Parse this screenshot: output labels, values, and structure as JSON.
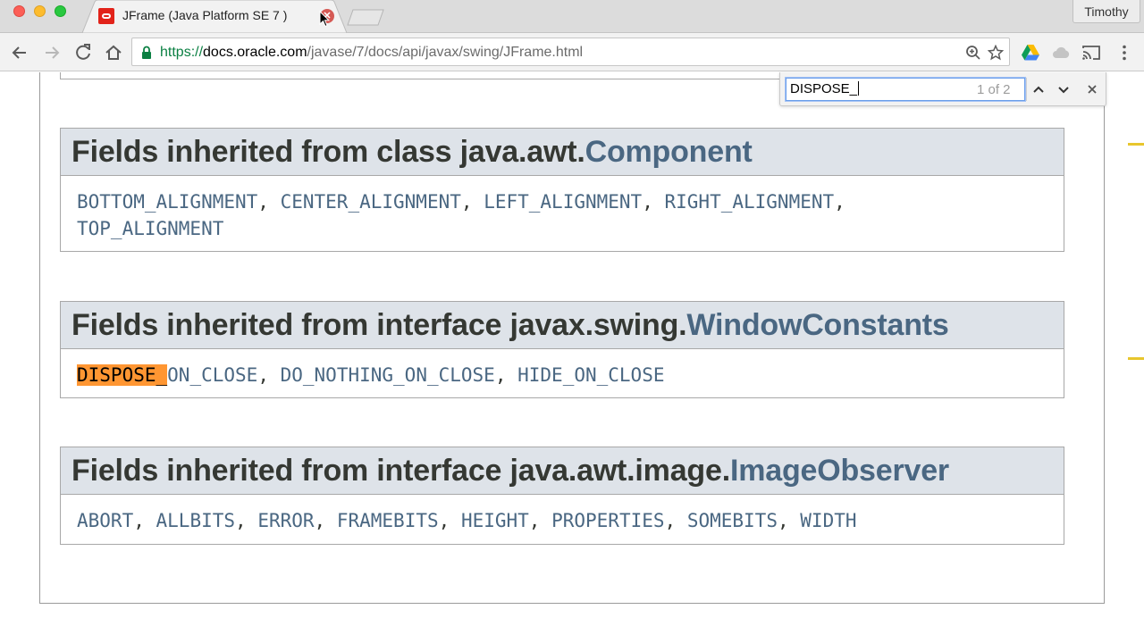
{
  "browser": {
    "profile_name": "Timothy",
    "tab": {
      "title": "JFrame (Java Platform SE 7 )",
      "close_icon": "close-icon",
      "favicon": "oracle-favicon"
    },
    "url": {
      "scheme": "https://",
      "host": "docs.oracle.com",
      "path": "/javase/7/docs/api/javax/swing/JFrame.html"
    },
    "nav_icons": [
      "back-arrow-icon",
      "forward-arrow-icon",
      "reload-icon",
      "home-icon"
    ],
    "omnibox_icons": [
      "zoom-icon",
      "bookmark-star-icon"
    ],
    "extension_icons": [
      "google-drive-icon",
      "cloud-icon",
      "cast-icon",
      "menu-kebab-icon"
    ]
  },
  "findbar": {
    "query": "DISPOSE_",
    "count": "1 of 2",
    "close_label": "×"
  },
  "sections": [
    {
      "header_prefix": "Fields inherited from class java.awt.",
      "header_link": "Component",
      "fields": [
        "BOTTOM_ALIGNMENT",
        "CENTER_ALIGNMENT",
        "LEFT_ALIGNMENT",
        "RIGHT_ALIGNMENT",
        "TOP_ALIGNMENT"
      ]
    },
    {
      "header_prefix": "Fields inherited from interface javax.swing.",
      "header_link": "WindowConstants",
      "highlight": "DISPOSE_",
      "highlight_rest": "ON_CLOSE",
      "fields": [
        "DO_NOTHING_ON_CLOSE",
        "HIDE_ON_CLOSE"
      ]
    },
    {
      "header_prefix": "Fields inherited from interface java.awt.image.",
      "header_link": "ImageObserver",
      "fields": [
        "ABORT",
        "ALLBITS",
        "ERROR",
        "FRAMEBITS",
        "HEIGHT",
        "PROPERTIES",
        "SOMEBITS",
        "WIDTH"
      ]
    }
  ],
  "colors": {
    "link": "#4a6782",
    "header_bg": "#dee3e9",
    "find_highlight": "#ff9632",
    "scroll_marker": "#e8c62d"
  }
}
